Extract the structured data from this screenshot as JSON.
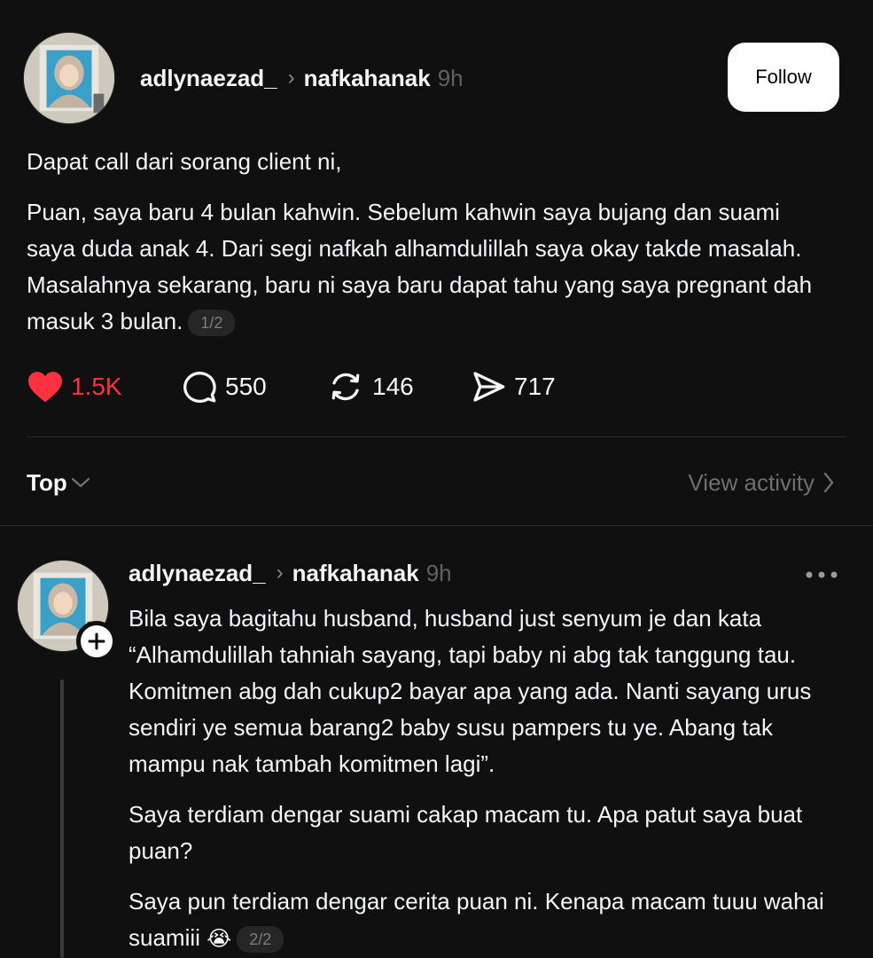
{
  "post": {
    "username": "adlynaezad_",
    "topic": "nafkahanak",
    "time": "9h",
    "follow_label": "Follow",
    "paragraphs": [
      "Dapat call dari sorang client ni,",
      "Puan, saya baru 4 bulan kahwin. Sebelum kahwin saya bujang dan suami saya duda anak 4. Dari segi nafkah alhamdulillah saya okay takde masalah. Masalahnya sekarang, baru ni saya baru dapat tahu yang saya pregnant dah masuk 3 bulan."
    ],
    "page_indicator": "1/2",
    "likes": "1.5K",
    "comments": "550",
    "reposts": "146",
    "shares": "717"
  },
  "sort": {
    "label": "Top",
    "view_activity": "View activity"
  },
  "reply": {
    "username": "adlynaezad_",
    "topic": "nafkahanak",
    "time": "9h",
    "paragraphs": [
      "Bila saya bagitahu husband, husband just senyum je dan kata “Alhamdulillah tahniah sayang, tapi baby ni abg tak tanggung tau. Komitmen abg dah cukup2 bayar apa yang ada. Nanti sayang urus sendiri ye semua barang2 baby susu pampers tu ye. Abang tak mampu nak tambah komitmen lagi”.",
      "Saya terdiam dengar suami cakap macam tu. Apa patut saya buat puan?",
      "Saya pun terdiam dengar cerita puan ni. Kenapa macam tuuu wahai suamiii"
    ],
    "emoji": "😭",
    "page_indicator": "2/2"
  },
  "colors": {
    "background": "#101010",
    "text": "#f3f5f7",
    "muted": "#616161",
    "like": "#ff3040"
  },
  "icons": [
    "heart-icon",
    "comment-icon",
    "repost-icon",
    "share-icon",
    "chevron-down-icon",
    "chevron-right-icon",
    "more-icon",
    "plus-icon"
  ]
}
